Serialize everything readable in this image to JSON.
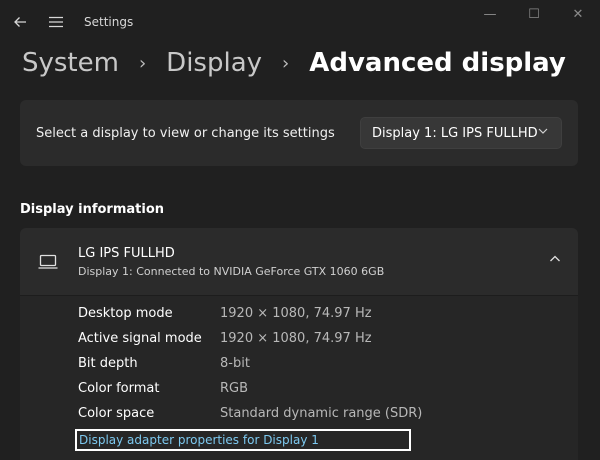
{
  "window": {
    "title": "Settings",
    "back_icon": "back-arrow-icon",
    "menu_icon": "hamburger-menu-icon",
    "minimize_glyph": "—",
    "maximize_glyph": "☐",
    "close_glyph": "✕"
  },
  "breadcrumb": {
    "items": [
      "System",
      "Display"
    ],
    "separator": "›",
    "current": "Advanced display"
  },
  "display_select": {
    "label": "Select a display to view or change its settings",
    "selected": "Display 1: LG IPS FULLHD"
  },
  "display_info": {
    "section_title": "Display information",
    "monitor_name": "LG IPS FULLHD",
    "connection": "Display 1: Connected to NVIDIA GeForce GTX 1060 6GB",
    "rows": [
      {
        "key": "Desktop mode",
        "value": "1920 × 1080, 74.97 Hz"
      },
      {
        "key": "Active signal mode",
        "value": "1920 × 1080, 74.97 Hz"
      },
      {
        "key": "Bit depth",
        "value": "8-bit"
      },
      {
        "key": "Color format",
        "value": "RGB"
      },
      {
        "key": "Color space",
        "value": "Standard dynamic range (SDR)"
      }
    ],
    "adapter_link": "Display adapter properties for Display 1"
  },
  "colors": {
    "background": "#202020",
    "card": "#2b2b2b",
    "link": "#7dc9f0"
  }
}
